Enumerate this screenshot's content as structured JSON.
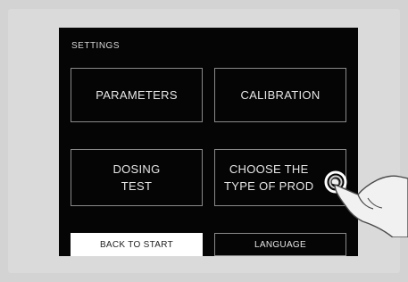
{
  "screen": {
    "title": "SETTINGS",
    "buttons": {
      "parameters": "PARAMETERS",
      "calibration": "CALIBRATION",
      "dosing_test": "DOSING\nTEST",
      "choose_product": "CHOOSE THE\nTYPE OF PROD",
      "back_to_start": "BACK TO START",
      "language": "LANGUAGE"
    }
  },
  "colors": {
    "screen_bg": "#050505",
    "button_border": "#8a8a8a",
    "text": "#e6e6e6",
    "back_button_bg": "#ffffff"
  },
  "icons": {
    "hand": "pointing-hand-icon",
    "touch": "touch-ring-icon"
  }
}
